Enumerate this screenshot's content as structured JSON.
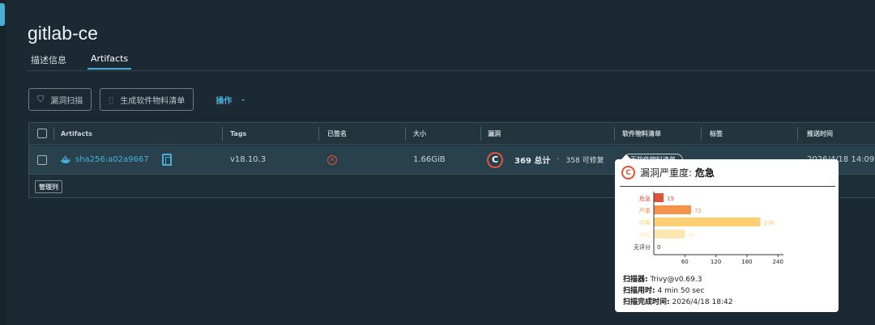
{
  "page": {
    "title": "gitlab-ce"
  },
  "tabs": [
    {
      "label": "描述信息",
      "active": false
    },
    {
      "label": "Artifacts",
      "active": true
    }
  ],
  "toolbar": {
    "scan_label": "漏洞扫描",
    "sbom_label": "生成软件物料清单",
    "actions_label": "操作"
  },
  "table": {
    "columns": [
      "Artifacts",
      "Tags",
      "已签名",
      "大小",
      "漏洞",
      "软件物料清单",
      "标签",
      "推送时间"
    ],
    "row": {
      "digest": "sha256:a02a9667",
      "tag": "v18.10.3",
      "size": "1.66GiB",
      "severity_letter": "C",
      "vuln_total": "369 总计",
      "vuln_sep": "·",
      "vuln_fixable": "358 可修复",
      "sbom_status": "无软件物料清单",
      "push_time": "2026/4/18 14:09"
    },
    "manage_columns_label": "管理列"
  },
  "popover": {
    "severity_letter": "C",
    "title_prefix": "漏洞严重度: ",
    "title_value": "危急",
    "scanner_label": "扫描器:",
    "scanner_value": "Trivy@v0.69.3",
    "duration_label": "扫描用时:",
    "duration_value": "4 min 50 sec",
    "completed_label": "扫描完成时间:",
    "completed_value": "2026/4/18 18:42"
  },
  "chart_data": {
    "type": "bar",
    "orientation": "horizontal",
    "categories": [
      "危急",
      "严重",
      "中等",
      "较低",
      "无评分"
    ],
    "values": [
      19,
      72,
      206,
      60,
      0
    ],
    "colors": [
      "#e0523a",
      "#f5934a",
      "#fcd071",
      "#fde7b0",
      "#c9c9c9"
    ],
    "x_ticks": [
      60,
      120,
      180,
      240
    ],
    "xlim": [
      0,
      260
    ]
  }
}
